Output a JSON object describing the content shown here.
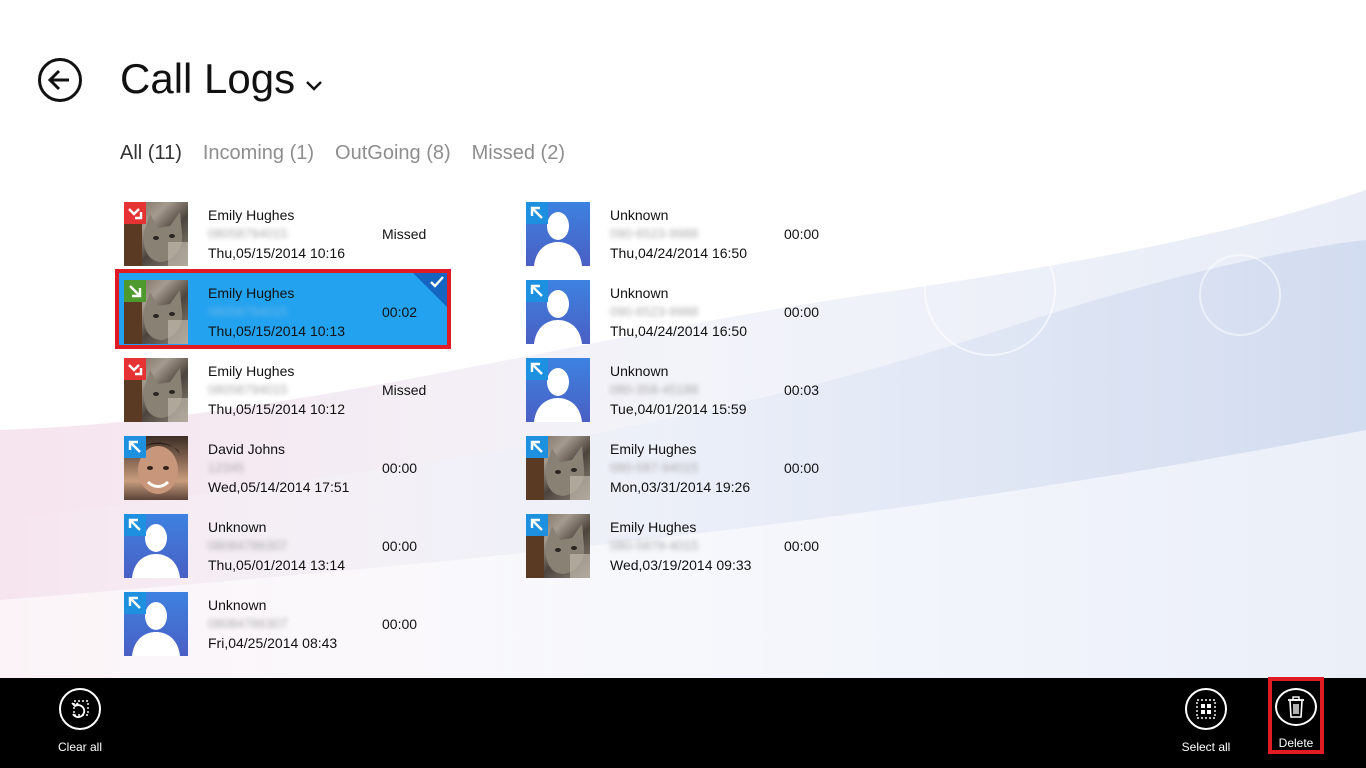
{
  "header": {
    "title": "Call Logs"
  },
  "filters": [
    {
      "label": "All (11)",
      "active": true
    },
    {
      "label": "Incoming (1)",
      "active": false
    },
    {
      "label": "OutGoing (8)",
      "active": false
    },
    {
      "label": "Missed (2)",
      "active": false
    }
  ],
  "calls": [
    {
      "name": "Emily Hughes",
      "number": "08058794015",
      "time": "Thu,05/15/2014 10:16",
      "duration": "Missed",
      "type": "missed",
      "avatar": "cat"
    },
    {
      "name": "Emily Hughes",
      "number": "08058794015",
      "time": "Thu,05/15/2014 10:13",
      "duration": "00:02",
      "type": "incoming",
      "avatar": "cat",
      "selected": true
    },
    {
      "name": "Emily Hughes",
      "number": "08058794015",
      "time": "Thu,05/15/2014 10:12",
      "duration": "Missed",
      "type": "missed",
      "avatar": "cat"
    },
    {
      "name": "David Johns",
      "number": "12345",
      "time": "Wed,05/14/2014 17:51",
      "duration": "00:00",
      "type": "outgoing",
      "avatar": "face"
    },
    {
      "name": "Unknown",
      "number": "08084786307",
      "time": "Thu,05/01/2014 13:14",
      "duration": "00:00",
      "type": "outgoing",
      "avatar": "unknown"
    },
    {
      "name": "Unknown",
      "number": "08084786307",
      "time": "Fri,04/25/2014 08:43",
      "duration": "00:00",
      "type": "outgoing",
      "avatar": "unknown"
    },
    {
      "name": "Unknown",
      "number": "090-6523-9988",
      "time": "Thu,04/24/2014 16:50",
      "duration": "00:00",
      "type": "outgoing",
      "avatar": "unknown"
    },
    {
      "name": "Unknown",
      "number": "090-6523-9988",
      "time": "Thu,04/24/2014 16:50",
      "duration": "00:00",
      "type": "outgoing",
      "avatar": "unknown"
    },
    {
      "name": "Unknown",
      "number": "080-358-45188",
      "time": "Tue,04/01/2014 15:59",
      "duration": "00:03",
      "type": "outgoing",
      "avatar": "unknown"
    },
    {
      "name": "Emily Hughes",
      "number": "080-587-94015",
      "time": "Mon,03/31/2014 19:26",
      "duration": "00:00",
      "type": "outgoing",
      "avatar": "cat"
    },
    {
      "name": "Emily Hughes",
      "number": "080-5879-4015",
      "time": "Wed,03/19/2014 09:33",
      "duration": "00:00",
      "type": "outgoing",
      "avatar": "cat"
    }
  ],
  "appbar": {
    "clear_all": "Clear all",
    "select_all": "Select all",
    "delete": "Delete"
  },
  "colors": {
    "missed": "#e53333",
    "incoming": "#4f9a2f",
    "outgoing": "#1e90e0",
    "selected": "#23a2f0",
    "highlight": "#e01b24"
  },
  "icons": {
    "back": "back-arrow-icon",
    "chevron": "chevron-down-icon",
    "clear_all": "clear-all-icon",
    "select_all": "select-all-icon",
    "delete": "trash-icon"
  }
}
